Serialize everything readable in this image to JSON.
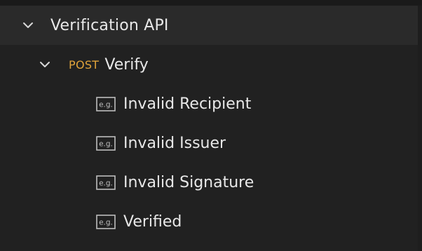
{
  "collection": {
    "name": "Verification API",
    "expanded": true
  },
  "request": {
    "method": "POST",
    "name": "Verify",
    "method_color": "#e0a33a",
    "expanded": true
  },
  "examples": [
    {
      "icon": "e.g.",
      "name": "Invalid Recipient"
    },
    {
      "icon": "e.g.",
      "name": "Invalid Issuer"
    },
    {
      "icon": "e.g.",
      "name": "Invalid Signature"
    },
    {
      "icon": "e.g.",
      "name": "Verified"
    }
  ]
}
